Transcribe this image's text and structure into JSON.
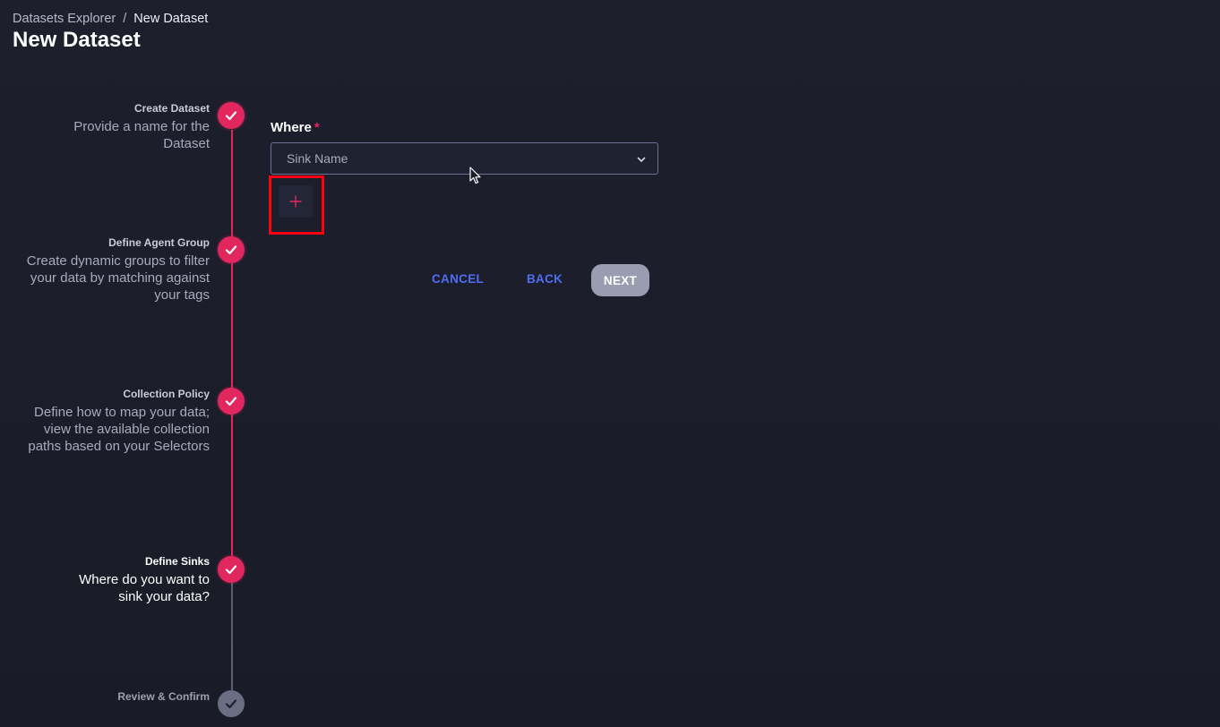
{
  "breadcrumb": {
    "parent": "Datasets Explorer",
    "separator": "/",
    "current": "New Dataset"
  },
  "page": {
    "title": "New Dataset"
  },
  "steps": [
    {
      "title": "Create Dataset",
      "description": "Provide a name for the Dataset",
      "status": "complete"
    },
    {
      "title": "Define Agent Group",
      "description": "Create dynamic groups to filter your data by matching against your tags",
      "status": "complete"
    },
    {
      "title": "Collection Policy",
      "description": "Define how to map your data; view the available collection paths based on your Selectors",
      "status": "complete"
    },
    {
      "title": "Define Sinks",
      "description": "Where do you want to sink your data?",
      "status": "active"
    },
    {
      "title": "Review & Confirm",
      "description": "",
      "status": "pending"
    }
  ],
  "form": {
    "where_label": "Where",
    "required_marker": "*",
    "sink_select_placeholder": "Sink Name",
    "add_symbol": "+"
  },
  "actions": {
    "cancel": "CANCEL",
    "back": "BACK",
    "next": "NEXT"
  },
  "colors": {
    "accent": "#e2275e",
    "link": "#4f6df5",
    "background": "#1b1d2a",
    "highlight": "#ff0010"
  },
  "icons": {
    "check": "check-icon",
    "chevron": "chevron-down-icon",
    "add": "plus-icon",
    "cursor": "mouse-cursor-icon"
  }
}
